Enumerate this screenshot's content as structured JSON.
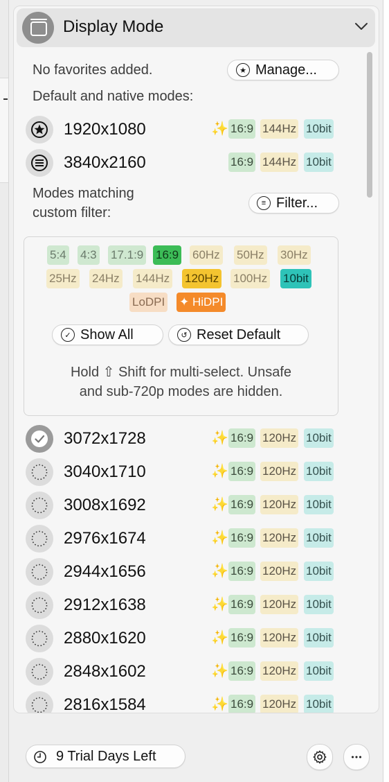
{
  "header": {
    "title": "Display Mode"
  },
  "favorites": {
    "empty_text": "No favorites added.",
    "manage_label": "Manage..."
  },
  "default_section": {
    "label": "Default and native modes:"
  },
  "default_modes": [
    {
      "resolution": "1920x1080",
      "icon": "star-icon",
      "hidpi": true,
      "tags": [
        "16:9",
        "144Hz",
        "10bit"
      ]
    },
    {
      "resolution": "3840x2160",
      "icon": "lines-icon",
      "hidpi": false,
      "tags": [
        "16:9",
        "144Hz",
        "10bit"
      ]
    }
  ],
  "custom_section": {
    "label_line1": "Modes matching",
    "label_line2": "custom filter:",
    "filter_label": "Filter..."
  },
  "filter_chips": {
    "row1": [
      "5:4",
      "4:3",
      "17.1:9",
      "16:9",
      "60Hz",
      "50Hz",
      "30Hz"
    ],
    "row2": [
      "25Hz",
      "24Hz",
      "144Hz",
      "120Hz",
      "100Hz",
      "10bit"
    ],
    "row3": [
      "LoDPI",
      "HiDPI"
    ],
    "selected": [
      "16:9",
      "120Hz",
      "10bit",
      "HiDPI"
    ]
  },
  "filter_buttons": {
    "show_all": "Show All",
    "reset_default": "Reset Default"
  },
  "hint": {
    "line1": "Hold ⇧ Shift for multi-select. Unsafe",
    "line2": "and sub-720p modes are hidden."
  },
  "modes": [
    {
      "resolution": "3072x1728",
      "selected": true,
      "tags": [
        "16:9",
        "120Hz",
        "10bit"
      ]
    },
    {
      "resolution": "3040x1710",
      "selected": false,
      "tags": [
        "16:9",
        "120Hz",
        "10bit"
      ]
    },
    {
      "resolution": "3008x1692",
      "selected": false,
      "tags": [
        "16:9",
        "120Hz",
        "10bit"
      ]
    },
    {
      "resolution": "2976x1674",
      "selected": false,
      "tags": [
        "16:9",
        "120Hz",
        "10bit"
      ]
    },
    {
      "resolution": "2944x1656",
      "selected": false,
      "tags": [
        "16:9",
        "120Hz",
        "10bit"
      ]
    },
    {
      "resolution": "2912x1638",
      "selected": false,
      "tags": [
        "16:9",
        "120Hz",
        "10bit"
      ]
    },
    {
      "resolution": "2880x1620",
      "selected": false,
      "tags": [
        "16:9",
        "120Hz",
        "10bit"
      ]
    },
    {
      "resolution": "2848x1602",
      "selected": false,
      "tags": [
        "16:9",
        "120Hz",
        "10bit"
      ]
    },
    {
      "resolution": "2816x1584",
      "selected": false,
      "tags": [
        "16:9",
        "120Hz",
        "10bit"
      ]
    }
  ],
  "footer": {
    "trial_label": "9 Trial Days Left",
    "settings_icon": "gear-icon",
    "more_icon": "ellipsis-icon"
  },
  "colors": {
    "accent_green": "#3cbc57",
    "accent_yellow": "#f4c430",
    "accent_teal": "#2ec3b8",
    "accent_orange": "#f48a2a",
    "sparkle": "#f0a030"
  }
}
